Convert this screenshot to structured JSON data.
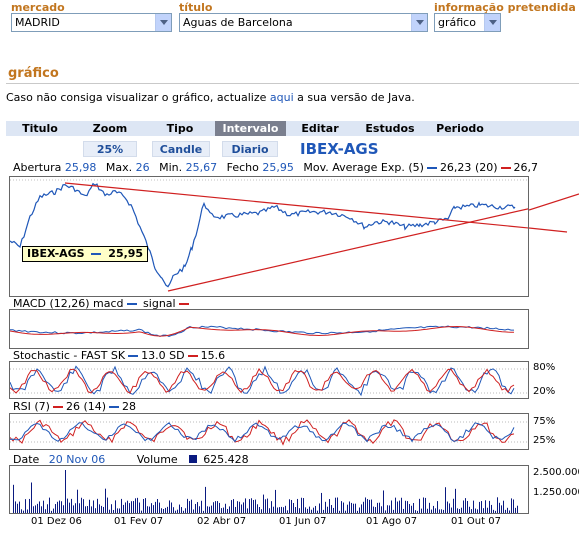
{
  "form": {
    "market_label": "mercado",
    "market_value": "MADRID",
    "title_label": "título",
    "title_value": "Aguas de Barcelona",
    "info_label": "informação pretendida",
    "info_value": "gráfico"
  },
  "page": {
    "heading": "gráfico",
    "notice_prefix": "Caso não consiga visualizar o gráfico, actualize ",
    "notice_link": "aqui",
    "notice_suffix": " a sua versão de Java."
  },
  "menu": [
    "Titulo",
    "Zoom",
    "Tipo",
    "Intervalo",
    "Editar",
    "Estudos",
    "Periodo"
  ],
  "menu_active": "Intervalo",
  "controls": {
    "zoom": "25%",
    "type": "Candle",
    "interval": "Diario",
    "symbol": "IBEX-AGS"
  },
  "quote": {
    "open_label": "Abertura",
    "open": "25,98",
    "max_label": "Max.",
    "max": "26",
    "min_label": "Min.",
    "min": "25,67",
    "close_label": "Fecho",
    "close": "25,95",
    "ma_label": "Mov. Average Exp. (5)",
    "ma5": "26,23",
    "ma20_label": "(20)",
    "ma20": "26,7"
  },
  "price_box": {
    "symbol": "IBEX-AGS",
    "value": "25,95"
  },
  "macd": {
    "label": "MACD (12,26)",
    "macd": "macd",
    "signal": "signal"
  },
  "stochastic": {
    "label": "Stochastic - FAST SK",
    "sk": "13.0",
    "sd_label": "SD",
    "sd": "15.6",
    "high": "80%",
    "low": "20%"
  },
  "rsi": {
    "label": "RSI (7)",
    "v1": "26",
    "p2": "(14)",
    "v2": "28",
    "high": "75%",
    "low": "25%"
  },
  "volume": {
    "date_label": "Date",
    "date": "20 Nov 06",
    "volume_label": "Volume",
    "volume": "625.428",
    "tick_high": "2.500.000",
    "tick_mid": "1.250.000"
  },
  "dates": [
    "01 Dez 06",
    "01 Fev 07",
    "02 Abr 07",
    "01 Jun 07",
    "01 Ago 07",
    "01 Out 07"
  ],
  "colors": {
    "accent": "#c2761f",
    "link": "#1f57b8",
    "price_line": "#1f57b8",
    "trend_line": "#d02020",
    "menu_bg": "#dde6f4",
    "menu_active": "#7a7f8e"
  }
}
